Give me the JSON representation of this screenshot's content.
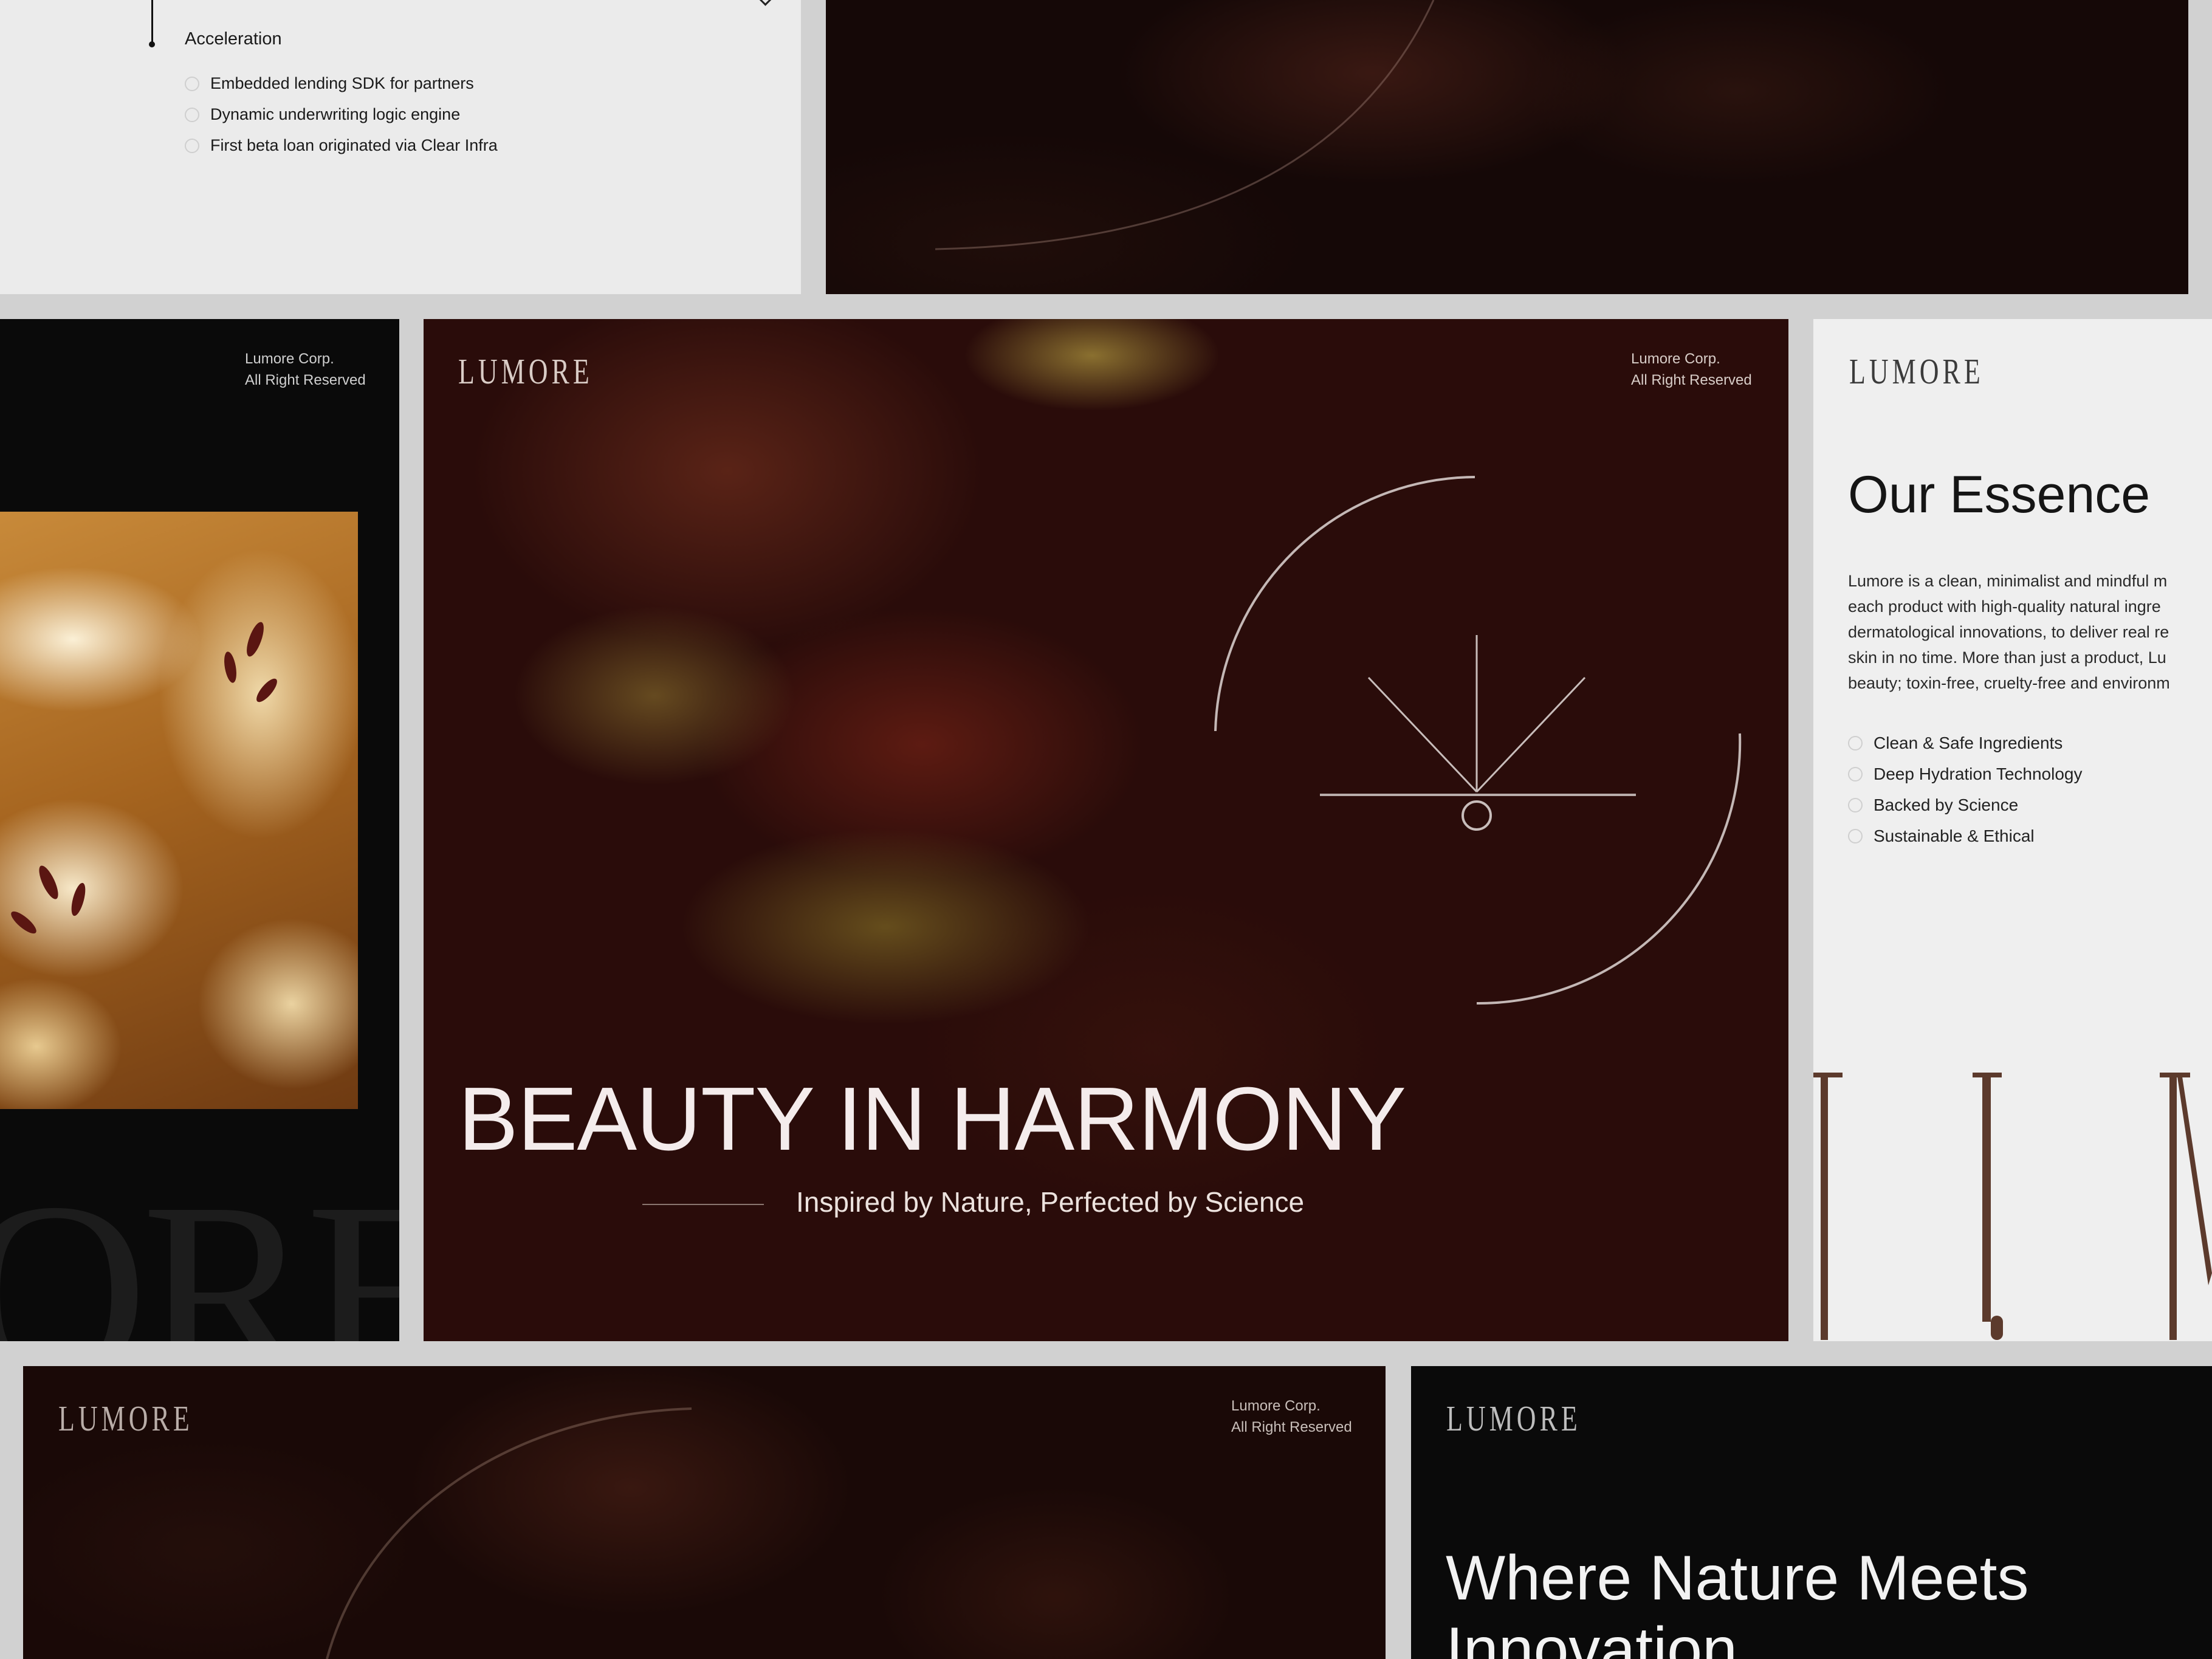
{
  "roadmap_panel": {
    "phase_label": "Acceleration",
    "items": [
      "Embedded lending SDK for partners",
      "Dynamic underwriting logic engine",
      "First beta loan originated via Clear Infra"
    ]
  },
  "brand": {
    "logo": "LUMORE",
    "corp_line1": "Lumore Corp.",
    "corp_line2": "All Right Reserved",
    "accent_color": "#5c3a2c"
  },
  "hero": {
    "headline": "BEAUTY IN HARMONY",
    "subline": "Inspired by Nature, Perfected by Science"
  },
  "essence": {
    "title": "Our Essence",
    "body_lines": [
      "Lumore is a clean, minimalist and mindful m",
      "each product with high-quality natural ingre",
      "dermatological innovations, to deliver real re",
      "skin in no time. More than just a product, Lu",
      "beauty; toxin-free, cruelty-free and environm"
    ],
    "features": [
      "Clean & Safe Ingredients",
      "Deep Hydration Technology",
      "Backed by Science",
      "Sustainable & Ethical"
    ]
  },
  "innovation": {
    "title_line1": "Where Nature Meets",
    "title_line2": "Innovation"
  },
  "icons": {
    "check": "check-circle-icon",
    "emblem": "sunrise-emblem-icon",
    "chevron": "chevron-down-icon"
  }
}
